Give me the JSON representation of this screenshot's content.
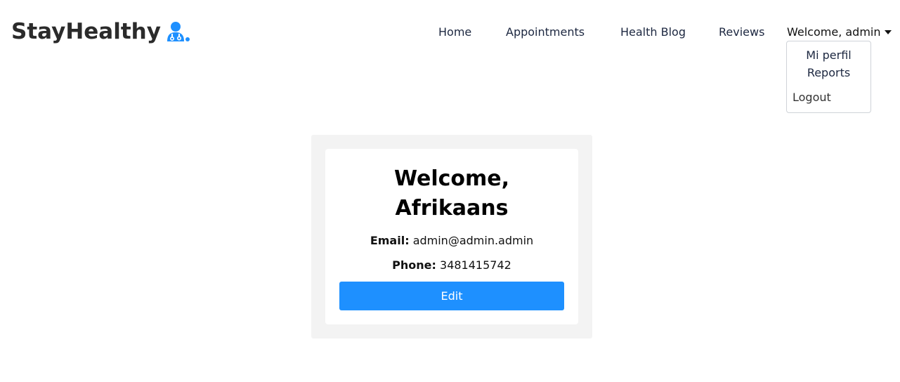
{
  "brand": {
    "name": "StayHealthy",
    "icon": "doctor-icon",
    "accent": "#1e90ff"
  },
  "nav": {
    "items": [
      {
        "label": "Home"
      },
      {
        "label": "Appointments"
      },
      {
        "label": "Health Blog"
      },
      {
        "label": "Reviews"
      }
    ],
    "welcome": "Welcome, admin",
    "dropdown": {
      "profile": "Mi perfil",
      "reports": "Reports",
      "logout": "Logout"
    }
  },
  "profile": {
    "greeting_line1": "Welcome,",
    "greeting_line2": "Afrikaans",
    "email_label": "Email:",
    "email": "admin@admin.admin",
    "phone_label": "Phone:",
    "phone": "3481415742",
    "edit_label": "Edit"
  }
}
